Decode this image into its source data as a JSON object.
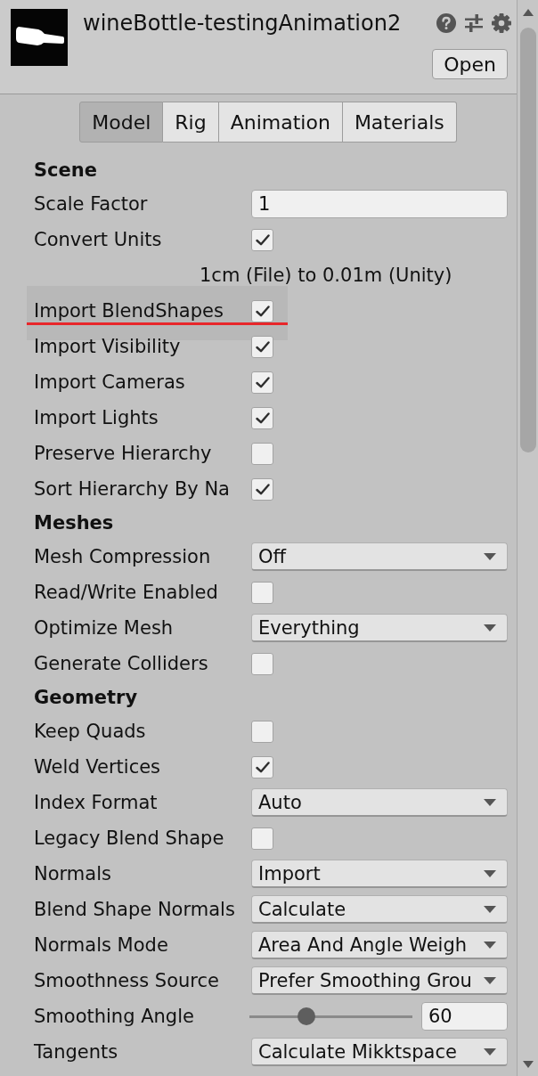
{
  "header": {
    "title": "wineBottle-testingAnimation2",
    "open_button": "Open"
  },
  "tabs": [
    {
      "label": "Model",
      "selected": true
    },
    {
      "label": "Rig",
      "selected": false
    },
    {
      "label": "Animation",
      "selected": false
    },
    {
      "label": "Materials",
      "selected": false
    }
  ],
  "sections": [
    {
      "title": "Scene",
      "rows": [
        {
          "kind": "field",
          "label": "Scale Factor",
          "value": "1",
          "highlighted": false
        },
        {
          "kind": "checkbox",
          "label": "Convert Units",
          "checked": true,
          "highlighted": false
        },
        {
          "kind": "note",
          "text": "1cm (File) to 0.01m (Unity)",
          "highlighted": false
        },
        {
          "kind": "checkbox",
          "label": "Import BlendShapes",
          "checked": true,
          "highlighted": true
        },
        {
          "kind": "checkbox",
          "label": "Import Visibility",
          "checked": true,
          "highlighted": false
        },
        {
          "kind": "checkbox",
          "label": "Import Cameras",
          "checked": true,
          "highlighted": false
        },
        {
          "kind": "checkbox",
          "label": "Import Lights",
          "checked": true,
          "highlighted": false
        },
        {
          "kind": "checkbox",
          "label": "Preserve Hierarchy",
          "checked": false,
          "highlighted": false
        },
        {
          "kind": "checkbox",
          "label": "Sort Hierarchy By Na",
          "checked": true,
          "highlighted": false
        }
      ]
    },
    {
      "title": "Meshes",
      "rows": [
        {
          "kind": "dropdown",
          "label": "Mesh Compression",
          "value": "Off",
          "highlighted": false
        },
        {
          "kind": "checkbox",
          "label": "Read/Write Enabled",
          "checked": false,
          "highlighted": false
        },
        {
          "kind": "dropdown",
          "label": "Optimize Mesh",
          "value": "Everything",
          "highlighted": false
        },
        {
          "kind": "checkbox",
          "label": "Generate Colliders",
          "checked": false,
          "highlighted": false
        }
      ]
    },
    {
      "title": "Geometry",
      "rows": [
        {
          "kind": "checkbox",
          "label": "Keep Quads",
          "checked": false,
          "highlighted": false
        },
        {
          "kind": "checkbox",
          "label": "Weld Vertices",
          "checked": true,
          "highlighted": false
        },
        {
          "kind": "dropdown",
          "label": "Index Format",
          "value": "Auto",
          "highlighted": false
        },
        {
          "kind": "checkbox",
          "label": "Legacy Blend Shape",
          "checked": false,
          "highlighted": false
        },
        {
          "kind": "dropdown",
          "label": "Normals",
          "value": "Import",
          "highlighted": false
        },
        {
          "kind": "dropdown",
          "label": "Blend Shape Normals",
          "value": "Calculate",
          "highlighted": false
        },
        {
          "kind": "dropdown",
          "label": "Normals Mode",
          "value": "Area And Angle Weigh",
          "highlighted": false
        },
        {
          "kind": "dropdown",
          "label": "Smoothness Source",
          "value": "Prefer Smoothing Grou",
          "highlighted": false
        },
        {
          "kind": "slider",
          "label": "Smoothing Angle",
          "level": 0.33,
          "value": "60",
          "highlighted": false
        },
        {
          "kind": "dropdown",
          "label": "Tangents",
          "value": "Calculate Mikktspace",
          "highlighted": false
        }
      ]
    }
  ]
}
